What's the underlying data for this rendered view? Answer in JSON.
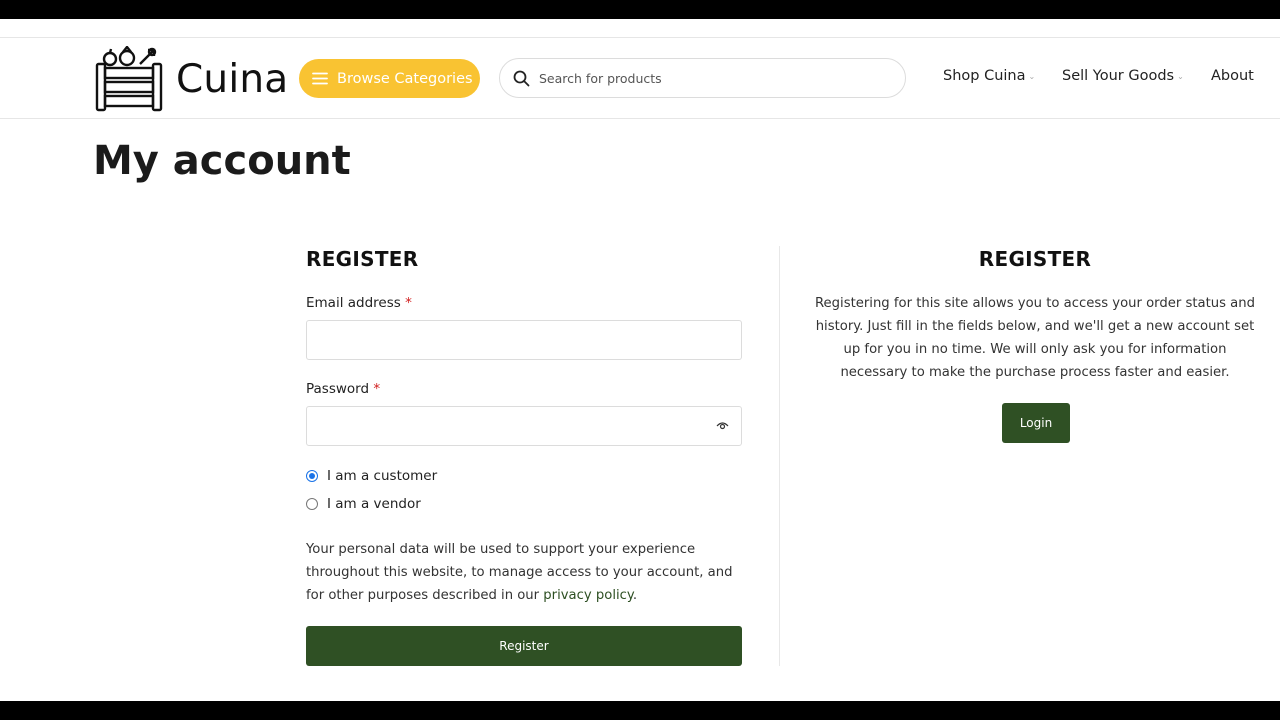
{
  "header": {
    "logo_text": "Cuina",
    "browse_label": "Browse Categories",
    "search_placeholder": "Search for products",
    "nav": {
      "shop_label": "Shop Cuina",
      "sell_label": "Sell Your Goods",
      "about_label": "About"
    }
  },
  "page": {
    "title": "My account"
  },
  "register_form": {
    "heading": "REGISTER",
    "email_label": "Email address",
    "password_label": "Password",
    "required_mark": "*",
    "email_value": "",
    "password_value": "",
    "role_options": [
      {
        "label": "I am a customer",
        "checked": true
      },
      {
        "label": "I am a vendor",
        "checked": false
      }
    ],
    "privacy_text": "Your personal data will be used to support your experience throughout this website, to manage access to your account, and for other purposes described in our",
    "privacy_link": "privacy policy",
    "privacy_end": ".",
    "submit_label": "Register"
  },
  "register_info": {
    "heading": "REGISTER",
    "text": "Registering for this site allows you to access your order status and history. Just fill in the fields below, and we'll get a new account set up for you in no time. We will only ask you for information necessary to make the purchase process faster and easier.",
    "login_label": "Login"
  },
  "colors": {
    "accent_yellow": "#f9c332",
    "button_green": "#2f5024",
    "required_red": "#d01b1b",
    "radio_blue": "#1a73e8"
  }
}
